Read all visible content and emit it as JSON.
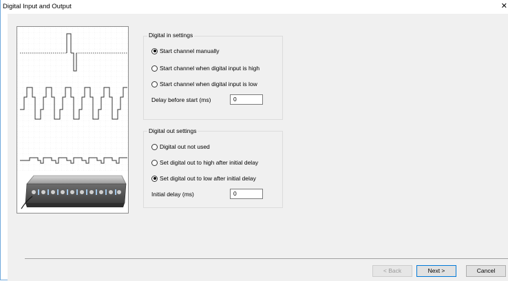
{
  "window": {
    "title": "Digital Input and Output",
    "close_glyph": "✕"
  },
  "digital_in": {
    "legend": "Digital in settings",
    "options": [
      {
        "label": "Start channel manually",
        "selected": true
      },
      {
        "label": "Start channel when digital input is high",
        "selected": false
      },
      {
        "label": "Start channel when digital input is low",
        "selected": false
      }
    ],
    "delay_label": "Delay before start (ms)",
    "delay_value": "0"
  },
  "digital_out": {
    "legend": "Digital out settings",
    "options": [
      {
        "label": "Digital out not used",
        "selected": false
      },
      {
        "label": "Set digital out to high after initial delay",
        "selected": false
      },
      {
        "label": "Set digital out to low after initial delay",
        "selected": true
      }
    ],
    "delay_label": "Initial delay (ms)",
    "delay_value": "0"
  },
  "buttons": {
    "back": "< Back",
    "next": "Next >",
    "cancel": "Cancel"
  },
  "illustration": {
    "description_icon": "digital-signal-waveforms-and-device-icon"
  }
}
